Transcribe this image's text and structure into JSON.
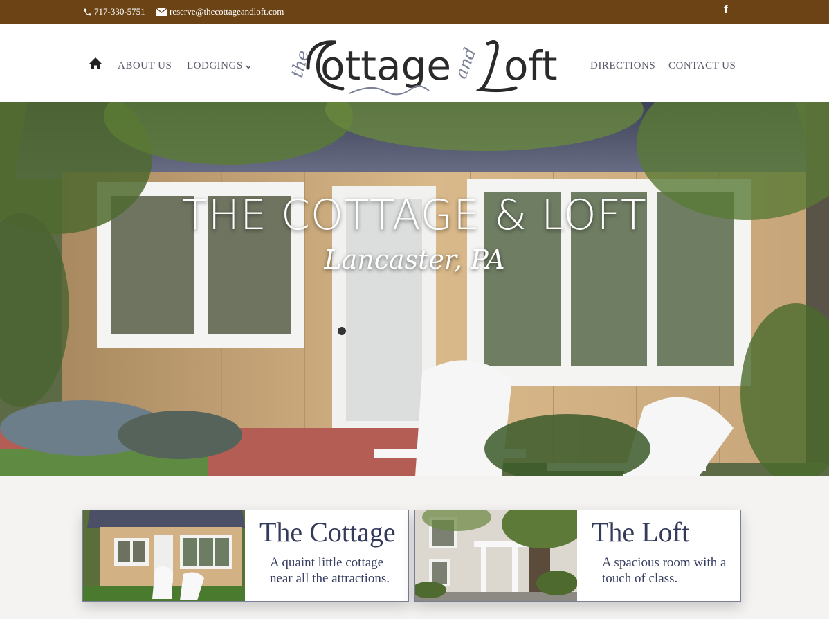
{
  "topbar": {
    "phone": "717-330-5751",
    "email": "reserve@thecottageandloft.com",
    "facebook": "f"
  },
  "nav": {
    "home_icon": "home-icon",
    "about": "ABOUT US",
    "lodgings": "LODGINGS",
    "directions": "DIRECTIONS",
    "contact": "CONTACT US"
  },
  "logo": {
    "the": "the",
    "cottage": "Cottage",
    "and": "and",
    "loft": "Loft"
  },
  "hero": {
    "title": "THE COTTAGE & LOFT",
    "subtitle": "Lancaster, PA"
  },
  "cards": [
    {
      "title": "The Cottage",
      "desc": "A quaint little cottage near all the attractions."
    },
    {
      "title": "The Loft",
      "desc": "A spacious room with a touch of class."
    }
  ],
  "colors": {
    "topbar": "#6b4314",
    "nav_text": "#5a5a6a",
    "card_title": "#333a5b",
    "page_bg": "#f4f3f1"
  }
}
